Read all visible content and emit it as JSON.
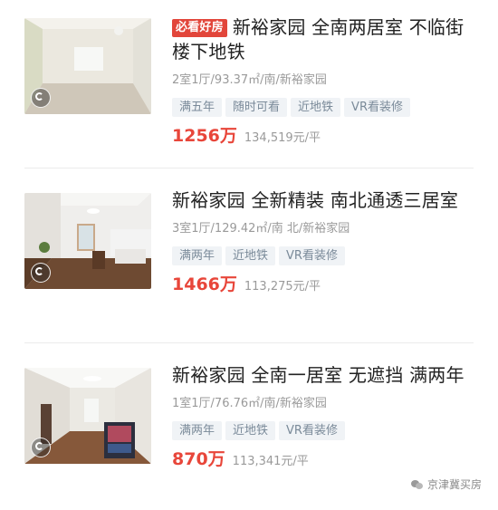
{
  "listings": [
    {
      "badge": "必看好房",
      "title": "新裕家园 全南两居室 不临街 楼下地铁",
      "meta": "2室1厅/93.37㎡/南/新裕家园",
      "tags": [
        "满五年",
        "随时可看",
        "近地铁",
        "VR看装修"
      ],
      "price": "1256万",
      "unit_price": "134,519元/平",
      "thumbnail_icon": "vr-icon"
    },
    {
      "badge": "",
      "title": "新裕家园 全新精装 南北通透三居室",
      "meta": "3室1厅/129.42㎡/南 北/新裕家园",
      "tags": [
        "满两年",
        "近地铁",
        "VR看装修"
      ],
      "price": "1466万",
      "unit_price": "113,275元/平",
      "thumbnail_icon": "vr-icon"
    },
    {
      "badge": "",
      "title": "新裕家园 全南一居室 无遮挡 满两年",
      "meta": "1室1厅/76.76㎡/南/新裕家园",
      "tags": [
        "满两年",
        "近地铁",
        "VR看装修"
      ],
      "price": "870万",
      "unit_price": "113,341元/平",
      "thumbnail_icon": "vr-icon"
    }
  ],
  "watermark": {
    "text": "京津冀买房",
    "icon": "wechat-icon"
  },
  "colors": {
    "price": "#e8463a",
    "badge_bg": "#e2463b",
    "tag_bg": "#f0f3f6",
    "tag_text": "#7a8a99"
  }
}
